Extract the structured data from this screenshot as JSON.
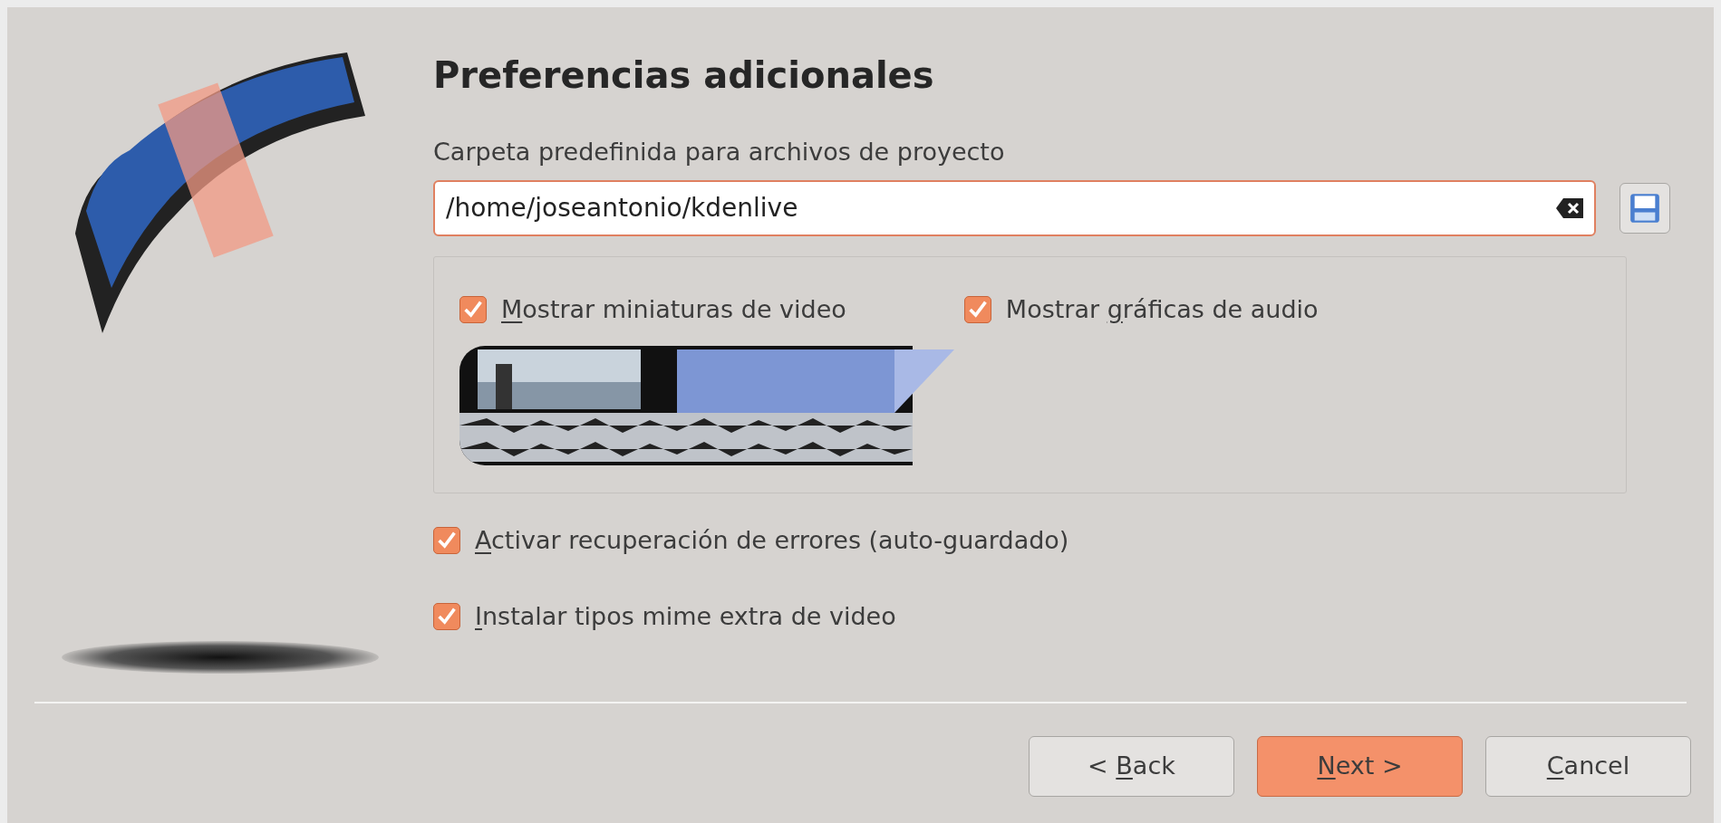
{
  "title": "Preferencias adicionales",
  "folder": {
    "label": "Carpeta predefinida para archivos de proyecto",
    "value": "/home/joseantonio/kdenlive"
  },
  "group": {
    "options": [
      {
        "key": "M",
        "after": "ostrar miniaturas de video",
        "checked": true
      },
      {
        "before": "Mostrar ",
        "key": "g",
        "after": "ráficas de audio",
        "checked": true
      }
    ]
  },
  "options": [
    {
      "key": "A",
      "after": "ctivar recuperación de errores (auto-guardado)",
      "checked": true
    },
    {
      "key": "I",
      "after": "nstalar tipos mime extra de video",
      "checked": true
    }
  ],
  "buttons": [
    {
      "before": "< ",
      "key": "B",
      "after": "ack",
      "default": false
    },
    {
      "key": "N",
      "after": "ext >",
      "default": true
    },
    {
      "key": "C",
      "after": "ancel",
      "default": false
    }
  ]
}
